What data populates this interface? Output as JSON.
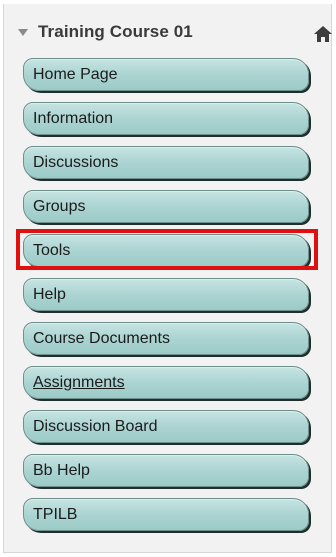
{
  "course": {
    "title": "Training Course 01"
  },
  "menu": {
    "items": [
      {
        "label": "Home Page"
      },
      {
        "label": "Information"
      },
      {
        "label": "Discussions"
      },
      {
        "label": "Groups"
      },
      {
        "label": "Tools"
      },
      {
        "label": "Help"
      },
      {
        "label": "Course Documents"
      },
      {
        "label": "Assignments"
      },
      {
        "label": "Discussion Board"
      },
      {
        "label": "Bb Help"
      },
      {
        "label": "TPILB"
      }
    ],
    "highlighted_item": "Tools",
    "highlight_color": "#e01010",
    "button_color": "#a9d3d0"
  }
}
